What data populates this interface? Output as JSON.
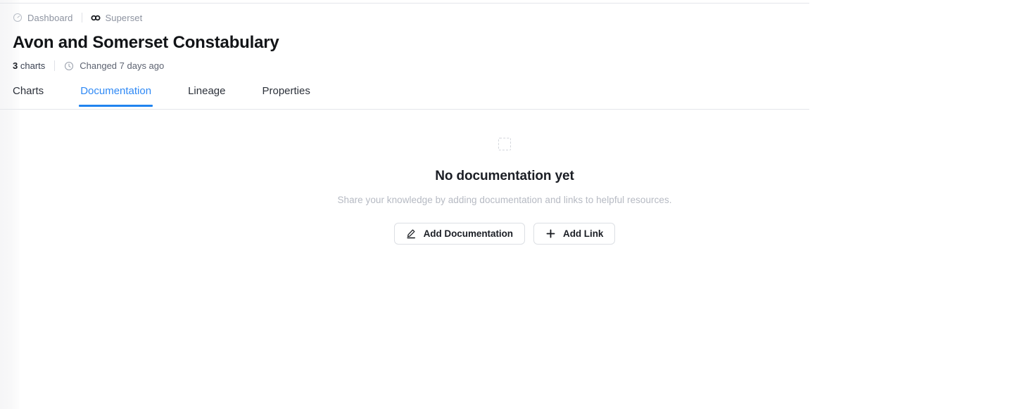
{
  "theme": {
    "accent": "#2184ef",
    "active_tab_text": "#2f89f5",
    "title_color": "#121417",
    "muted_text": "#8d93a0",
    "subtle_text": "#b6bac3",
    "rule_color": "#e4e6ea",
    "button_border": "#dcdfe4",
    "page_background": "#ffffff",
    "rail_background": "#f7f7f8"
  },
  "breadcrumb": {
    "items": [
      {
        "label": "Dashboard",
        "icon": "dashboard-gauge-icon"
      },
      {
        "label": "Superset",
        "icon": "superset-logo-icon"
      }
    ]
  },
  "header": {
    "title": "Avon and Somerset Constabulary",
    "meta": {
      "charts_count": "3",
      "charts_label": "charts",
      "changed_icon": "clock-icon",
      "changed_text": "Changed 7 days ago"
    }
  },
  "tabs": [
    {
      "label": "Charts",
      "active": false
    },
    {
      "label": "Documentation",
      "active": true
    },
    {
      "label": "Lineage",
      "active": false
    },
    {
      "label": "Properties",
      "active": false
    }
  ],
  "empty_state": {
    "icon": "dashed-square-icon",
    "title": "No documentation yet",
    "subtitle": "Share your knowledge by adding documentation and links to helpful resources.",
    "actions": [
      {
        "label": "Add Documentation",
        "icon": "pencil-edit-icon"
      },
      {
        "label": "Add Link",
        "icon": "plus-icon"
      }
    ]
  }
}
